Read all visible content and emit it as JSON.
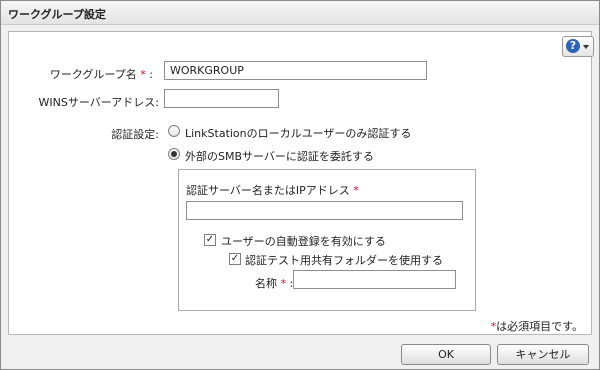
{
  "dialog": {
    "title": "ワークグループ設定"
  },
  "help": {
    "icon": "question-icon",
    "symbol": "?"
  },
  "form": {
    "workgroup": {
      "label": "ワークグループ名",
      "required_mark": "*",
      "colon": ":",
      "value": "WORKGROUP"
    },
    "wins": {
      "label": "WINSサーバーアドレス:",
      "value": ""
    },
    "auth": {
      "label": "認証設定:",
      "options": [
        {
          "label": "LinkStationのローカルユーザーのみ認証する",
          "selected": false
        },
        {
          "label": "外部のSMBサーバーに認証を委託する",
          "selected": true
        }
      ]
    },
    "external": {
      "server_label": "認証サーバー名またはIPアドレス",
      "required_mark": "*",
      "server_value": "",
      "auto_register": {
        "label": "ユーザーの自動登録を有効にする",
        "checked": true,
        "mark": "✓"
      },
      "test_folder": {
        "label": "認証テスト用共有フォルダーを使用する",
        "checked": true,
        "mark": "✓"
      },
      "name": {
        "label": "名称",
        "required_mark": "*",
        "colon": ":",
        "value": ""
      }
    }
  },
  "note": {
    "mark": "*",
    "text": "は必須項目です。"
  },
  "buttons": {
    "ok": "OK",
    "cancel": "キャンセル"
  },
  "colors": {
    "required": "#e0002a",
    "help_icon": "#2e63b8"
  }
}
